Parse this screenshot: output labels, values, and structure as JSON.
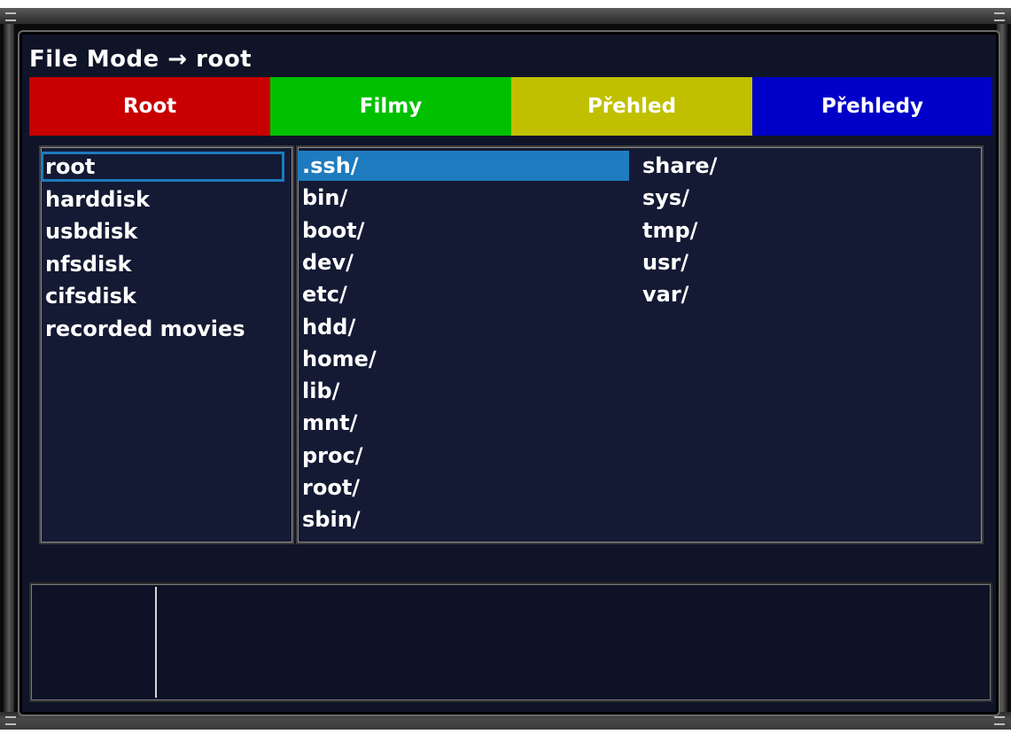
{
  "header": {
    "title": "File Mode → root"
  },
  "buttons": [
    {
      "label": "Root",
      "color": "#c80000"
    },
    {
      "label": "Filmy",
      "color": "#00c000"
    },
    {
      "label": "Přehled",
      "color": "#c0c000"
    },
    {
      "label": "Přehledy",
      "color": "#0000c8"
    }
  ],
  "locations": {
    "selected_index": 0,
    "items": [
      "root",
      "harddisk",
      "usbdisk",
      "nfsdisk",
      "cifsdisk",
      "recorded movies"
    ]
  },
  "files": {
    "selected_index": 0,
    "items": [
      ".ssh/",
      "bin/",
      "boot/",
      "dev/",
      "etc/",
      "hdd/",
      "home/",
      "lib/",
      "mnt/",
      "proc/",
      "root/",
      "sbin/",
      "share/",
      "sys/",
      "tmp/",
      "usr/",
      "var/"
    ]
  },
  "colors": {
    "selection": "#1e7bbf",
    "panel_background": "#101428"
  }
}
